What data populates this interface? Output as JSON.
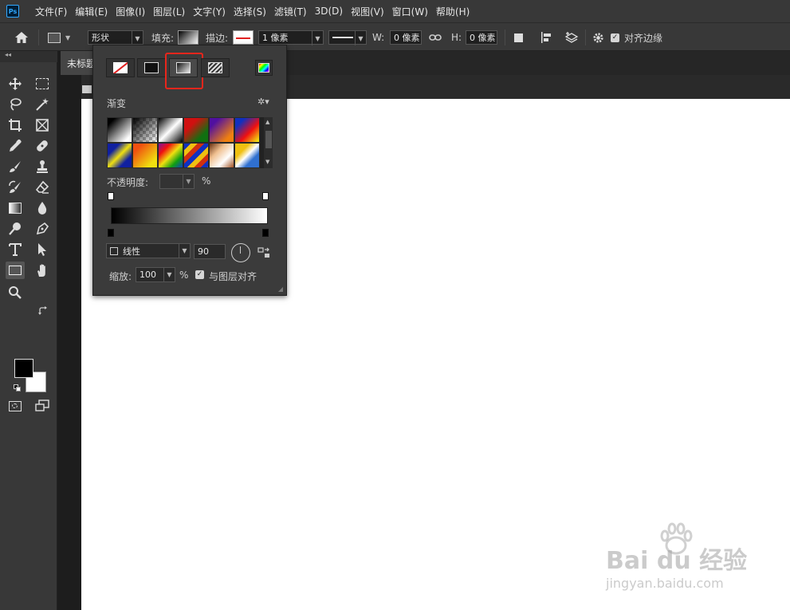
{
  "app": {
    "logo": "Ps"
  },
  "menu": [
    "文件(F)",
    "编辑(E)",
    "图像(I)",
    "图层(L)",
    "文字(Y)",
    "选择(S)",
    "滤镜(T)",
    "3D(D)",
    "视图(V)",
    "窗口(W)",
    "帮助(H)"
  ],
  "options": {
    "mode_value": "形状",
    "fill_label": "填充:",
    "stroke_label": "描边:",
    "stroke_width": "1 像素",
    "w_label": "W:",
    "w_value": "0 像素",
    "h_label": "H:",
    "h_value": "0 像素",
    "align_edges_label": "对齐边缘"
  },
  "document": {
    "tab_title": "未标题"
  },
  "popover": {
    "section_title": "渐变",
    "opacity_label": "不透明度:",
    "opacity_unit": "%",
    "style_value": "线性",
    "angle_value": "90",
    "scale_label": "缩放:",
    "scale_value": "100",
    "scale_unit": "%",
    "align_layer_label": "与图层对齐",
    "highlight_color": "#e8261c"
  },
  "watermark": {
    "brand": "Bai du 经验",
    "url": "jingyan.baidu.com"
  }
}
